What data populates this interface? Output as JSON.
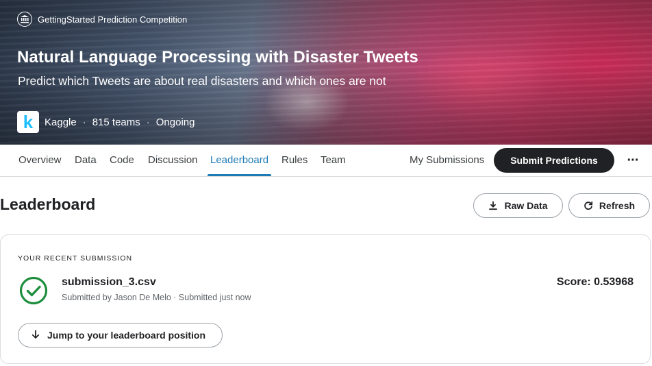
{
  "hero": {
    "competition_type": "GettingStarted Prediction Competition",
    "title": "Natural Language Processing with Disaster Tweets",
    "subtitle": "Predict which Tweets are about real disasters and which ones are not",
    "host_logo_letter": "k",
    "host": "Kaggle",
    "separator": "·",
    "teams": "815 teams",
    "status": "Ongoing"
  },
  "tabs": {
    "overview": "Overview",
    "data": "Data",
    "code": "Code",
    "discussion": "Discussion",
    "leaderboard": "Leaderboard",
    "rules": "Rules",
    "team": "Team",
    "my_submissions": "My Submissions",
    "submit": "Submit Predictions",
    "more": "···",
    "active": "Leaderboard"
  },
  "leaderboard": {
    "title": "Leaderboard",
    "raw_data_label": "Raw Data",
    "refresh_label": "Refresh"
  },
  "recent_submission": {
    "section_label": "YOUR RECENT SUBMISSION",
    "file_name": "submission_3.csv",
    "meta": "Submitted by Jason De Melo · Submitted just now",
    "score": "Score: 0.53968",
    "status_icon": "check-circle-icon",
    "jump_label": "Jump to your leaderboard position"
  },
  "colors": {
    "accent": "#1f7bb5",
    "success": "#1e8e3e",
    "dark_button": "#202124",
    "kaggle_blue": "#20beff"
  }
}
